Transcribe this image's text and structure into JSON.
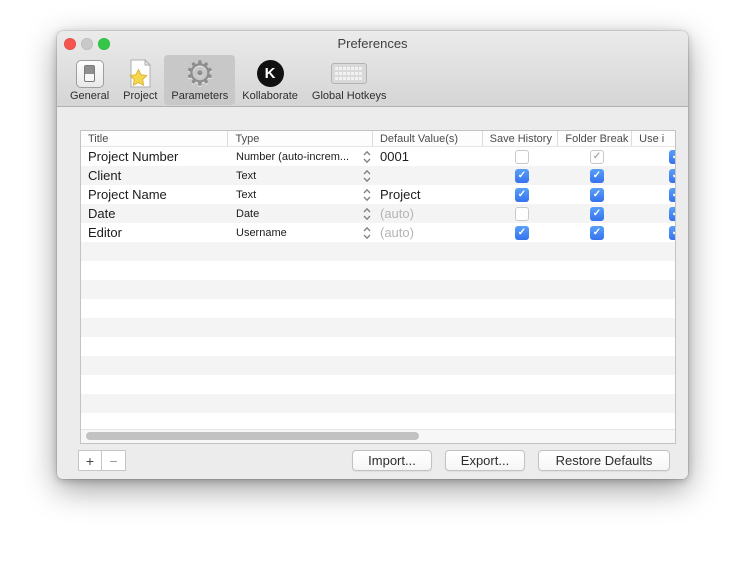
{
  "window": {
    "title": "Preferences"
  },
  "toolbar": {
    "tabs": [
      {
        "label": "General"
      },
      {
        "label": "Project"
      },
      {
        "label": "Parameters",
        "selected": true
      },
      {
        "label": "Kollaborate"
      },
      {
        "label": "Global Hotkeys"
      }
    ]
  },
  "table": {
    "columns": [
      "Title",
      "Type",
      "Default Value(s)",
      "Save History",
      "Folder Break",
      "Use i"
    ],
    "rows": [
      {
        "title": "Project Number",
        "type": "Number (auto-increm...",
        "default": "0001",
        "placeholder": false,
        "save_history": "unchecked",
        "folder_break": "checked-disabled",
        "use_in": "checked"
      },
      {
        "title": "Client",
        "type": "Text",
        "default": "",
        "placeholder": false,
        "save_history": "checked",
        "folder_break": "checked",
        "use_in": "checked"
      },
      {
        "title": "Project Name",
        "type": "Text",
        "default": "Project",
        "placeholder": false,
        "save_history": "checked",
        "folder_break": "checked",
        "use_in": "checked"
      },
      {
        "title": "Date",
        "type": "Date",
        "default": "(auto)",
        "placeholder": true,
        "save_history": "unchecked",
        "folder_break": "checked",
        "use_in": "checked"
      },
      {
        "title": "Editor",
        "type": "Username",
        "default": "(auto)",
        "placeholder": true,
        "save_history": "checked",
        "folder_break": "checked",
        "use_in": "checked"
      }
    ],
    "empty_stripes": 10
  },
  "footer": {
    "add_label": "+",
    "remove_label": "−",
    "import_label": "Import...",
    "export_label": "Export...",
    "restore_label": "Restore Defaults"
  },
  "colors": {
    "accent_blue": "#3d7ff2",
    "traffic_red": "#f4564e",
    "traffic_gray": "#c9c9c9",
    "traffic_green": "#34c748",
    "toolbar_selected": "#c8c8c8",
    "row_stripe": "#f4f4f5"
  }
}
